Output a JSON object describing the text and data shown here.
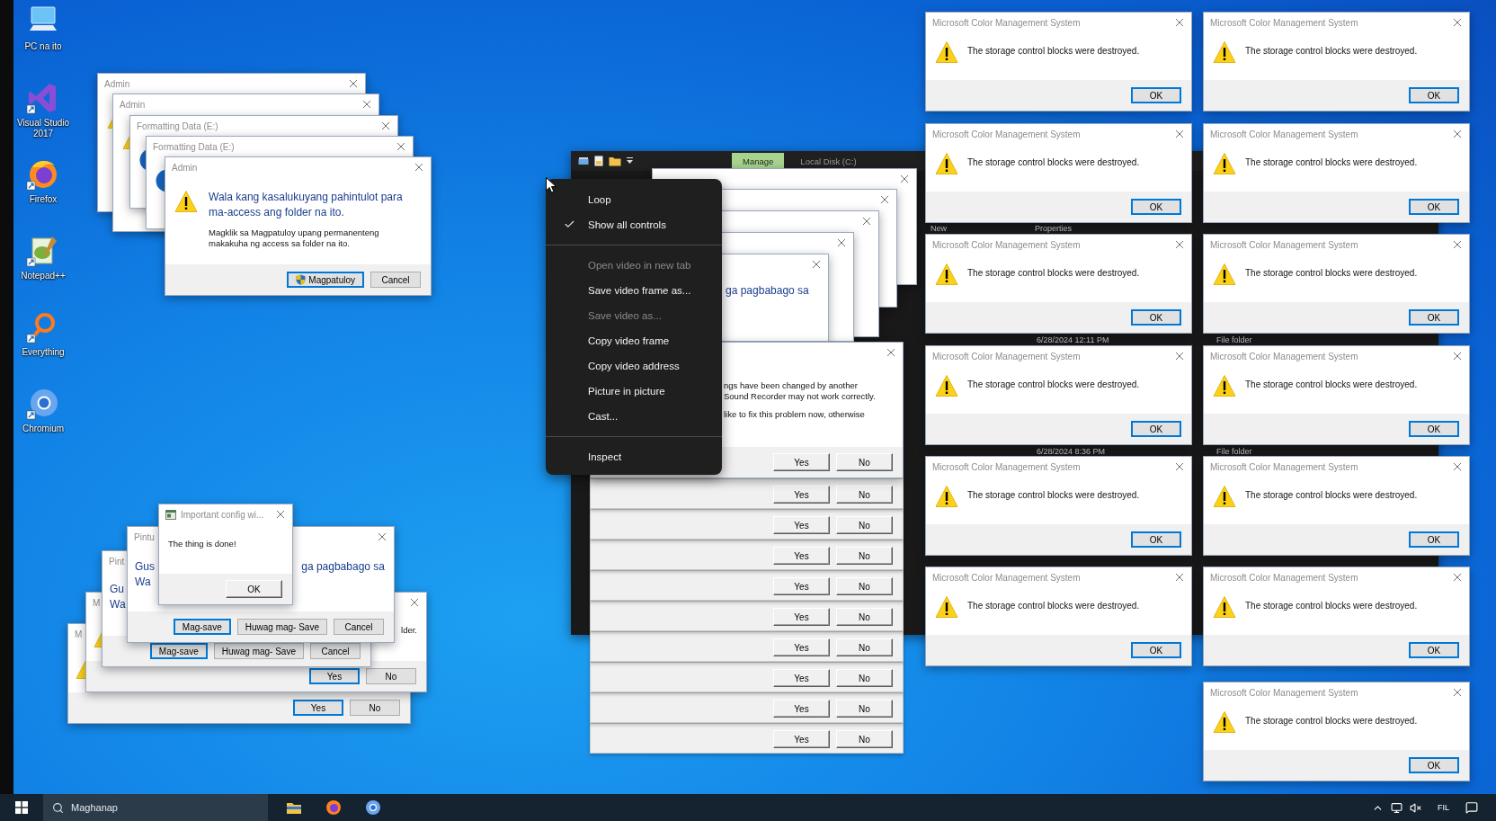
{
  "desktop_icons": [
    {
      "kind": "pc",
      "label": "PC na ito"
    },
    {
      "kind": "vs",
      "label": "Visual Studio 2017"
    },
    {
      "kind": "firefox",
      "label": "Firefox"
    },
    {
      "kind": "notepad",
      "label": "Notepad++"
    },
    {
      "kind": "everything",
      "label": "Everything"
    },
    {
      "kind": "chromium",
      "label": "Chromium"
    }
  ],
  "admin_stack": [
    {
      "kind": "dialog",
      "title": "Admin"
    },
    {
      "kind": "dialog",
      "title": "Admin"
    },
    {
      "kind": "dialog",
      "title": "Formatting Data (E:)"
    },
    {
      "kind": "dialog",
      "title": "Formatting Data (E:)"
    },
    {
      "kind": "dialog",
      "title": "Admin",
      "heading": [
        "Wala kang kasalukuyang pahintulot para",
        "ma-access ang folder na ito."
      ],
      "message": [
        [
          "Magklik sa Magpatuloy upang permanenteng",
          "makakuha ng access sa folder na ito."
        ]
      ],
      "buttons": [
        {
          "label": "Magpatuloy",
          "kind": "modern",
          "focused": true,
          "shield": true
        },
        {
          "label": "Cancel",
          "kind": "modern",
          "focused": false
        }
      ]
    }
  ],
  "save_stack": [
    {
      "kind": "dialog",
      "title": "M",
      "buttons": [
        {
          "label": "Yes",
          "kind": "modern",
          "focused": true
        },
        {
          "label": "No",
          "kind": "modern",
          "focused": false
        }
      ]
    },
    {
      "kind": "dialog",
      "title": "M",
      "message": [
        [
          {
            "right": "lder."
          }
        ]
      ],
      "buttons": [
        {
          "label": "Yes",
          "kind": "modern",
          "focused": true
        },
        {
          "label": "No",
          "kind": "modern",
          "focused": false
        }
      ]
    },
    {
      "kind": "dialog",
      "title": "Pint",
      "heading": [
        "Gu",
        "Wa"
      ],
      "buttons": [
        {
          "label": "Mag-save",
          "kind": "modern",
          "focused": true
        },
        {
          "label": "Huwag mag- Save",
          "kind": "modern",
          "focused": false
        },
        {
          "label": "Cancel",
          "kind": "modern",
          "focused": false
        }
      ]
    },
    {
      "kind": "dialog",
      "title": "Pintu",
      "heading": [
        {
          "left": "Gus",
          "right": "ga pagbabago sa"
        },
        "Wa"
      ],
      "buttons": [
        {
          "label": "Mag-save",
          "kind": "modern",
          "focused": true
        },
        {
          "label": "Huwag mag- Save",
          "kind": "modern",
          "focused": false
        },
        {
          "label": "Cancel",
          "kind": "modern",
          "focused": false
        }
      ]
    },
    {
      "kind": "dialog",
      "title": "Important config wi...",
      "app_icon": true,
      "message": [
        [
          "The thing is done!"
        ]
      ],
      "buttons": [
        {
          "label": "OK",
          "kind": "classic",
          "focused": false
        }
      ]
    }
  ],
  "explorer": {
    "ribbon_tabs": [
      {
        "label": "Manage",
        "selected": true
      },
      {
        "label": "Local Disk (C:)",
        "selected": false
      }
    ],
    "ribbon_labels": [
      "New",
      "Properties"
    ],
    "rows": [
      {
        "date": "6/28/2024 12:11 PM",
        "type": "File folder"
      },
      {
        "date": "6/28/2024 8:36 PM",
        "type": "File folder"
      }
    ]
  },
  "middle_stack": [
    {
      "kind": "dialog"
    },
    {
      "kind": "dialog"
    },
    {
      "kind": "dialog"
    },
    {
      "kind": "dialog"
    },
    {
      "kind": "dialog",
      "heading": [
        "ga pagbabago sa"
      ]
    },
    {
      "kind": "dialog",
      "message": [
        [
          "ngs have been changed by another",
          "Sound Recorder may not work correctly."
        ],
        [
          "like to fix this problem now, otherwise"
        ]
      ],
      "buttons": [
        {
          "label": "Yes",
          "kind": "classic",
          "focused": false
        },
        {
          "label": "No",
          "kind": "classic",
          "focused": false
        }
      ]
    },
    {
      "kind": "strip",
      "buttons": [
        {
          "label": "Yes",
          "kind": "classic",
          "focused": false
        },
        {
          "label": "No",
          "kind": "classic",
          "focused": false
        }
      ]
    },
    {
      "kind": "strip",
      "buttons": [
        {
          "label": "Yes",
          "kind": "classic",
          "focused": false
        },
        {
          "label": "No",
          "kind": "classic",
          "focused": false
        }
      ]
    },
    {
      "kind": "strip",
      "buttons": [
        {
          "label": "Yes",
          "kind": "classic",
          "focused": false
        },
        {
          "label": "No",
          "kind": "classic",
          "focused": false
        }
      ]
    },
    {
      "kind": "strip",
      "buttons": [
        {
          "label": "Yes",
          "kind": "classic",
          "focused": false
        },
        {
          "label": "No",
          "kind": "classic",
          "focused": false
        }
      ]
    },
    {
      "kind": "strip",
      "buttons": [
        {
          "label": "Yes",
          "kind": "classic",
          "focused": false
        },
        {
          "label": "No",
          "kind": "classic",
          "focused": false
        }
      ]
    },
    {
      "kind": "strip",
      "buttons": [
        {
          "label": "Yes",
          "kind": "classic",
          "focused": false
        },
        {
          "label": "No",
          "kind": "classic",
          "focused": false
        }
      ]
    },
    {
      "kind": "strip",
      "buttons": [
        {
          "label": "Yes",
          "kind": "classic",
          "focused": false
        },
        {
          "label": "No",
          "kind": "classic",
          "focused": false
        }
      ]
    },
    {
      "kind": "strip",
      "buttons": [
        {
          "label": "Yes",
          "kind": "classic",
          "focused": false
        },
        {
          "label": "No",
          "kind": "classic",
          "focused": false
        }
      ]
    },
    {
      "kind": "strip",
      "buttons": [
        {
          "label": "Yes",
          "kind": "classic",
          "focused": false
        },
        {
          "label": "No",
          "kind": "classic",
          "focused": false
        }
      ]
    }
  ],
  "context_menu": [
    {
      "kind": "item",
      "label": "Loop",
      "checked": false,
      "disabled": false
    },
    {
      "kind": "item",
      "label": "Show all controls",
      "checked": true,
      "disabled": false
    },
    {
      "kind": "separator"
    },
    {
      "kind": "item",
      "label": "Open video in new tab",
      "checked": false,
      "disabled": true
    },
    {
      "kind": "item",
      "label": "Save video frame as...",
      "checked": false,
      "disabled": false
    },
    {
      "kind": "item",
      "label": "Save video as...",
      "checked": false,
      "disabled": true
    },
    {
      "kind": "item",
      "label": "Copy video frame",
      "checked": false,
      "disabled": false
    },
    {
      "kind": "item",
      "label": "Copy video address",
      "checked": false,
      "disabled": false
    },
    {
      "kind": "item",
      "label": "Picture in picture",
      "checked": false,
      "disabled": false
    },
    {
      "kind": "item",
      "label": "Cast...",
      "checked": false,
      "disabled": false
    },
    {
      "kind": "separator"
    },
    {
      "kind": "item",
      "label": "Inspect",
      "checked": false,
      "disabled": false
    }
  ],
  "color_dialogs": [
    {
      "title": "Microsoft Color Management System",
      "message": "The storage control blocks were destroyed.",
      "button": "OK"
    },
    {
      "title": "Microsoft Color Management System",
      "message": "The storage control blocks were destroyed.",
      "button": "OK"
    },
    {
      "title": "Microsoft Color Management System",
      "message": "The storage control blocks were destroyed.",
      "button": "OK"
    },
    {
      "title": "Microsoft Color Management System",
      "message": "The storage control blocks were destroyed.",
      "button": "OK"
    },
    {
      "title": "Microsoft Color Management System",
      "message": "The storage control blocks were destroyed.",
      "button": "OK"
    },
    {
      "title": "Microsoft Color Management System",
      "message": "The storage control blocks were destroyed.",
      "button": "OK"
    },
    {
      "title": "Microsoft Color Management System",
      "message": "The storage control blocks were destroyed.",
      "button": "OK"
    },
    {
      "title": "Microsoft Color Management System",
      "message": "The storage control blocks were destroyed.",
      "button": "OK"
    },
    {
      "title": "Microsoft Color Management System",
      "message": "The storage control blocks were destroyed.",
      "button": "OK"
    },
    {
      "title": "Microsoft Color Management System",
      "message": "The storage control blocks were destroyed.",
      "button": "OK"
    },
    {
      "title": "Microsoft Color Management System",
      "message": "The storage control blocks were destroyed.",
      "button": "OK"
    },
    {
      "title": "Microsoft Color Management System",
      "message": "The storage control blocks were destroyed.",
      "button": "OK"
    },
    {
      "title": "Microsoft Color Management System",
      "message": "The storage control blocks were destroyed.",
      "button": "OK"
    }
  ],
  "taskbar": {
    "search_placeholder": "Maghanap",
    "apps": [
      {
        "kind": "explorer"
      },
      {
        "kind": "firefox"
      },
      {
        "kind": "chromium"
      }
    ],
    "language": "FIL"
  }
}
